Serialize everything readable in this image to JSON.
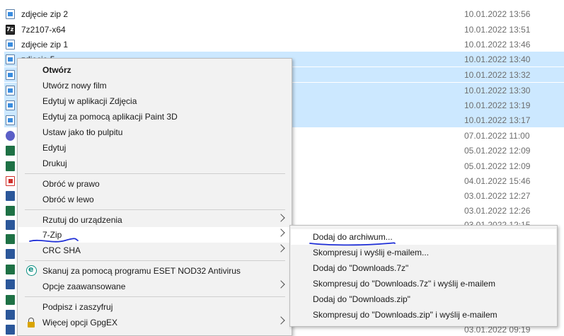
{
  "files": [
    {
      "name": "zdjęcie zip 2",
      "date": "10.01.2022 13:56",
      "icon": "image-file-icon",
      "selected": false
    },
    {
      "name": "7z2107-x64",
      "date": "10.01.2022 13:51",
      "icon": "7zip-exe-icon",
      "selected": false
    },
    {
      "name": "zdjęcie zip 1",
      "date": "10.01.2022 13:46",
      "icon": "image-file-icon",
      "selected": false
    },
    {
      "name": "zdjęcie 5",
      "date": "10.01.2022 13:40",
      "icon": "image-file-icon",
      "selected": true
    },
    {
      "name": "",
      "date": "10.01.2022 13:32",
      "icon": "image-file-icon",
      "selected": true
    },
    {
      "name": "",
      "date": "10.01.2022 13:30",
      "icon": "image-file-icon",
      "selected": true
    },
    {
      "name": "",
      "date": "10.01.2022 13:19",
      "icon": "image-file-icon",
      "selected": true
    },
    {
      "name": "",
      "date": "10.01.2022 13:17",
      "icon": "image-file-icon",
      "selected": true
    },
    {
      "name": "",
      "date": "07.01.2022 11:00",
      "icon": "teams-file-icon",
      "selected": false
    },
    {
      "name": "",
      "date": "05.01.2022 12:09",
      "icon": "excel-file-icon",
      "selected": false
    },
    {
      "name": "",
      "date": "05.01.2022 12:09",
      "icon": "excel-file-icon",
      "selected": false
    },
    {
      "name": "",
      "date": "04.01.2022 15:46",
      "icon": "pdf-file-icon",
      "selected": false
    },
    {
      "name": "",
      "date": "03.01.2022 12:27",
      "icon": "word-file-icon",
      "selected": false
    },
    {
      "name": "",
      "date": "03.01.2022 12:26",
      "icon": "excel-file-icon",
      "selected": false
    },
    {
      "name": "",
      "date": "03.01.2022 12:15",
      "icon": "word-file-icon",
      "selected": false
    },
    {
      "name": "",
      "date": "",
      "icon": "excel-file-icon",
      "selected": false
    },
    {
      "name": "",
      "date": "",
      "icon": "word-file-icon",
      "selected": false
    },
    {
      "name": "",
      "date": "",
      "icon": "excel-file-icon",
      "selected": false
    },
    {
      "name": "",
      "date": "",
      "icon": "word-file-icon",
      "selected": false
    },
    {
      "name": "",
      "date": "",
      "icon": "excel-file-icon",
      "selected": false
    },
    {
      "name": "",
      "date": "",
      "icon": "word-file-icon",
      "selected": false
    },
    {
      "name": "",
      "date": "03.01.2022 09:19",
      "icon": "word-file-icon",
      "selected": false
    }
  ],
  "context_menu": {
    "items": [
      {
        "label": "Otwórz",
        "bold": true
      },
      {
        "label": "Utwórz nowy film"
      },
      {
        "label": "Edytuj w aplikacji Zdjęcia"
      },
      {
        "label": "Edytuj za pomocą aplikacji Paint 3D"
      },
      {
        "label": "Ustaw jako tło pulpitu"
      },
      {
        "label": "Edytuj"
      },
      {
        "label": "Drukuj"
      },
      {
        "label": "Obróć w prawo"
      },
      {
        "label": "Obróć w lewo"
      },
      {
        "label": "Rzutuj do urządzenia",
        "submenu": true
      },
      {
        "label": "7-Zip",
        "submenu": true,
        "hover": true
      },
      {
        "label": "CRC SHA",
        "submenu": true
      },
      {
        "label": "Skanuj za pomocą programu ESET NOD32 Antivirus",
        "icon": "eset-icon"
      },
      {
        "label": "Opcje zaawansowane",
        "submenu": true
      },
      {
        "label": "Podpisz i zaszyfruj"
      },
      {
        "label": "Więcej opcji GpgEX",
        "submenu": true,
        "icon": "lock-icon"
      }
    ]
  },
  "submenu_7zip": {
    "items": [
      {
        "label": "Dodaj do archiwum...",
        "hover": true
      },
      {
        "label": "Skompresuj i wyślij e-mailem..."
      },
      {
        "label": "Dodaj do \"Downloads.7z\""
      },
      {
        "label": "Skompresuj do \"Downloads.7z\" i wyślij e-mailem"
      },
      {
        "label": "Dodaj do \"Downloads.zip\""
      },
      {
        "label": "Skompresuj do \"Downloads.zip\" i wyślij e-mailem"
      }
    ]
  },
  "colors": {
    "selection": "#cce8ff",
    "menu_bg": "#f2f2f2",
    "annotation_ink": "#1f2fd6"
  }
}
